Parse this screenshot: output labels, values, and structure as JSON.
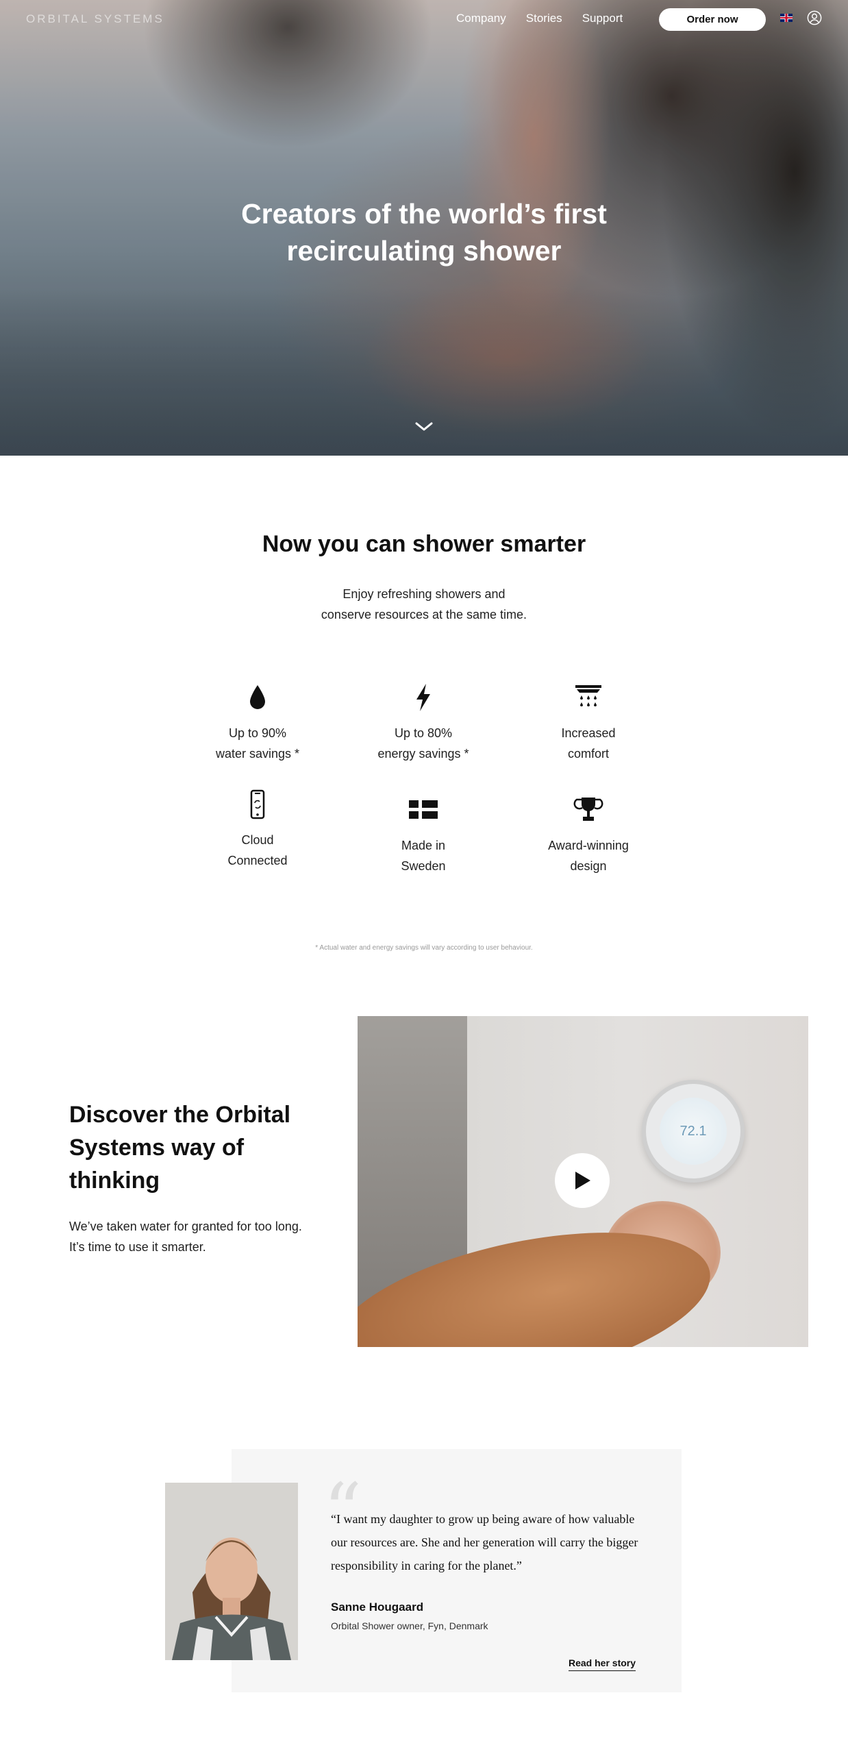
{
  "nav": {
    "logo": "ORBITAL SYSTEMS",
    "links": [
      "Company",
      "Stories",
      "Support"
    ],
    "order_button": "Order now",
    "language_icon": "uk-flag-icon",
    "account_icon": "user-circle-icon"
  },
  "hero": {
    "title_line1": "Creators of the world’s first",
    "title_line2": "recirculating shower",
    "scroll_icon": "chevron-down-icon"
  },
  "smarter": {
    "title": "Now you can shower smarter",
    "subtitle_line1": "Enjoy refreshing showers and",
    "subtitle_line2": "conserve resources at the same time.",
    "features": [
      {
        "icon": "water-drop-icon",
        "label": "Up to 90%\nwater savings *"
      },
      {
        "icon": "lightning-icon",
        "label": "Up to 80%\nenergy savings *"
      },
      {
        "icon": "shower-head-icon",
        "label": "Increased\ncomfort"
      },
      {
        "icon": "smartphone-sync-icon",
        "label": "Cloud\nConnected"
      },
      {
        "icon": "swedish-flag-icon",
        "label": "Made in\nSweden"
      },
      {
        "icon": "trophy-icon",
        "label": "Award-winning\ndesign"
      }
    ],
    "disclaimer": "* Actual water and energy savings will vary according to user behaviour."
  },
  "discover": {
    "title": "Discover the Orbital Systems way of thinking",
    "text": "We’ve taken water for granted for too long. It’s time to use it smarter.",
    "video": {
      "thermostat_reading": "72.1",
      "play_icon": "play-icon"
    }
  },
  "testimonial": {
    "quote_mark": "“",
    "quote": "“I want my daughter to grow up being aware of how valuable our resources are. She and her generation will carry the bigger responsibility in caring for the planet.”",
    "name": "Sanne Hougaard",
    "meta": "Orbital Shower owner, Fyn, Denmark",
    "link": "Read her story"
  },
  "colors": {
    "accent": "#111111",
    "card_bg": "#f6f6f6",
    "thermostat_text": "#6d9ab7"
  }
}
